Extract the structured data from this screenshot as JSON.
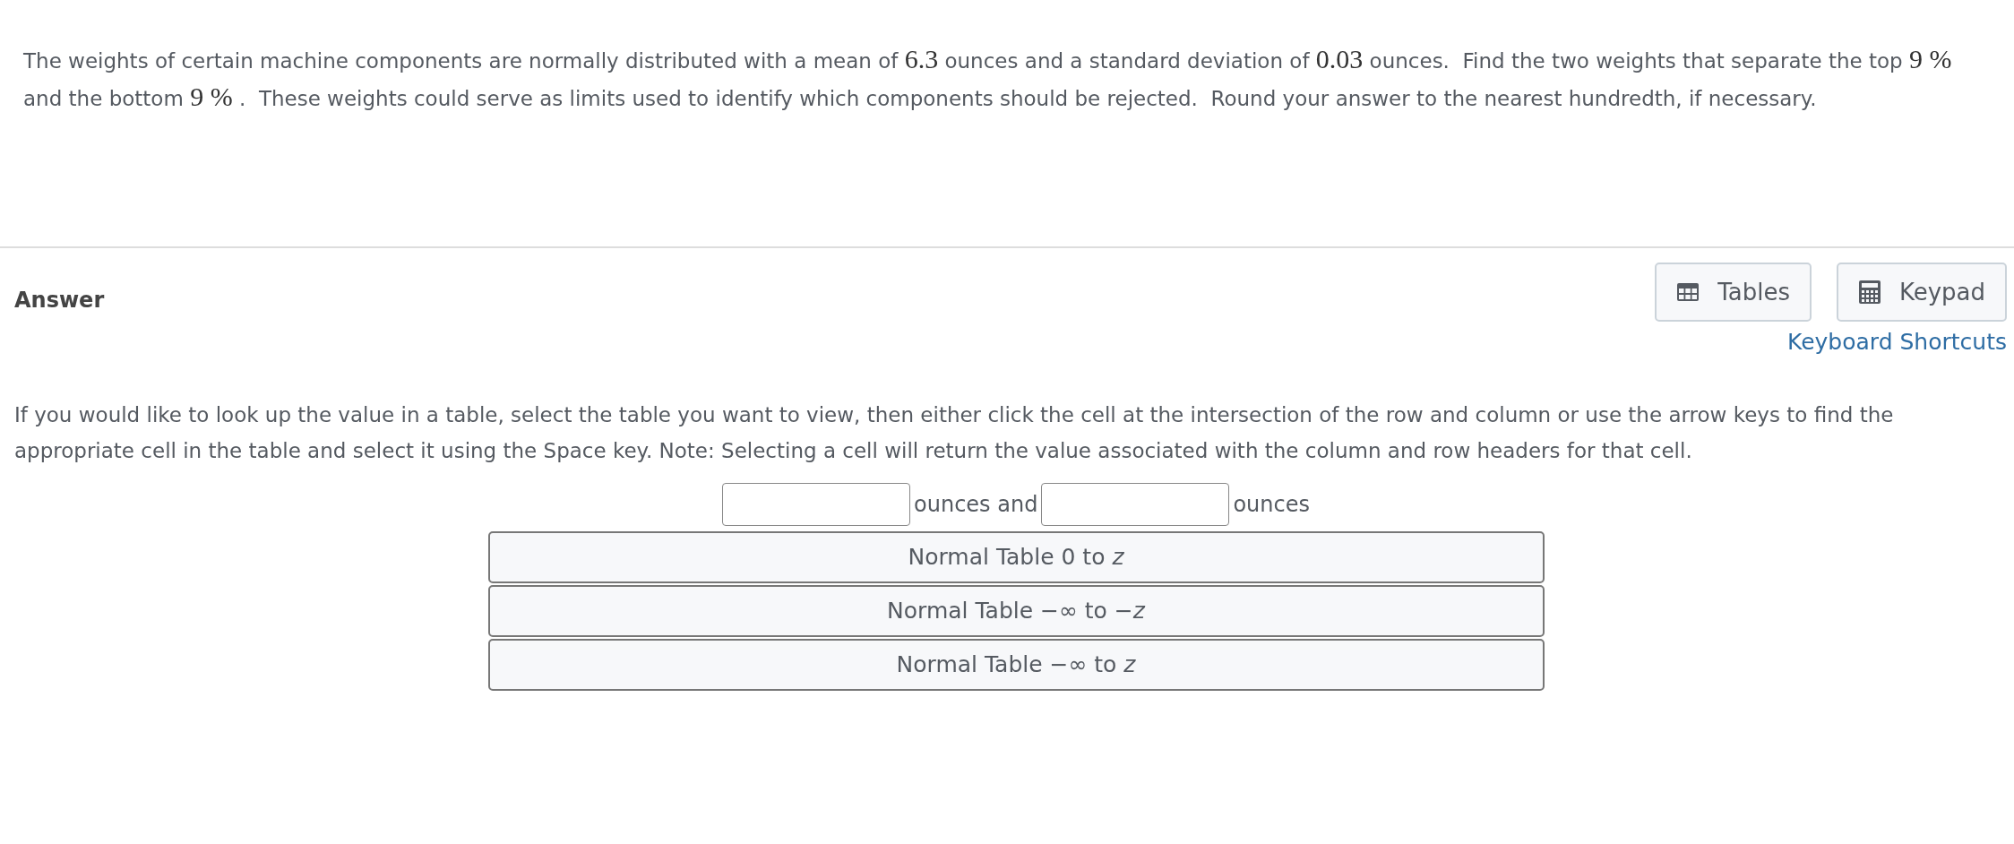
{
  "question": {
    "segments": [
      {
        "kind": "text",
        "text": "The weights of certain machine components are normally distributed with a mean of "
      },
      {
        "kind": "math",
        "text": "6.3"
      },
      {
        "kind": "text",
        "text": " ounces and a standard deviation of "
      },
      {
        "kind": "math",
        "text": "0.03"
      },
      {
        "kind": "text",
        "text": " ounces.  Find the two weights that separate the top "
      },
      {
        "kind": "math",
        "text": "9 %"
      },
      {
        "kind": "text",
        "text": "  and the bottom "
      },
      {
        "kind": "math",
        "text": "9 %"
      },
      {
        "kind": "text",
        "text": " .  These weights could serve as limits used to identify which components should be rejected.  Round your answer to the nearest hundredth, if necessary."
      }
    ]
  },
  "answer": {
    "heading": "Answer",
    "tools": [
      {
        "kind": "tables",
        "label": "Tables"
      },
      {
        "kind": "keypad",
        "label": "Keypad"
      }
    ],
    "shortcuts_link": "Keyboard Shortcuts",
    "instructions": "If you would like to look up the value in a table, select the table you want to view, then either click the cell at the intersection of the row and column or use the arrow keys to find the appropriate cell in the table and select it using the Space key. Note: Selecting a cell will return the value associated with the column and row headers for that cell.",
    "blanks": [
      {
        "unit": "ounces and"
      },
      {
        "unit": "ounces"
      }
    ],
    "table_buttons": [
      "Normal Table 0 to *z*",
      "Normal Table −∞ to −*z*",
      "Normal Table −∞ to *z*"
    ]
  }
}
